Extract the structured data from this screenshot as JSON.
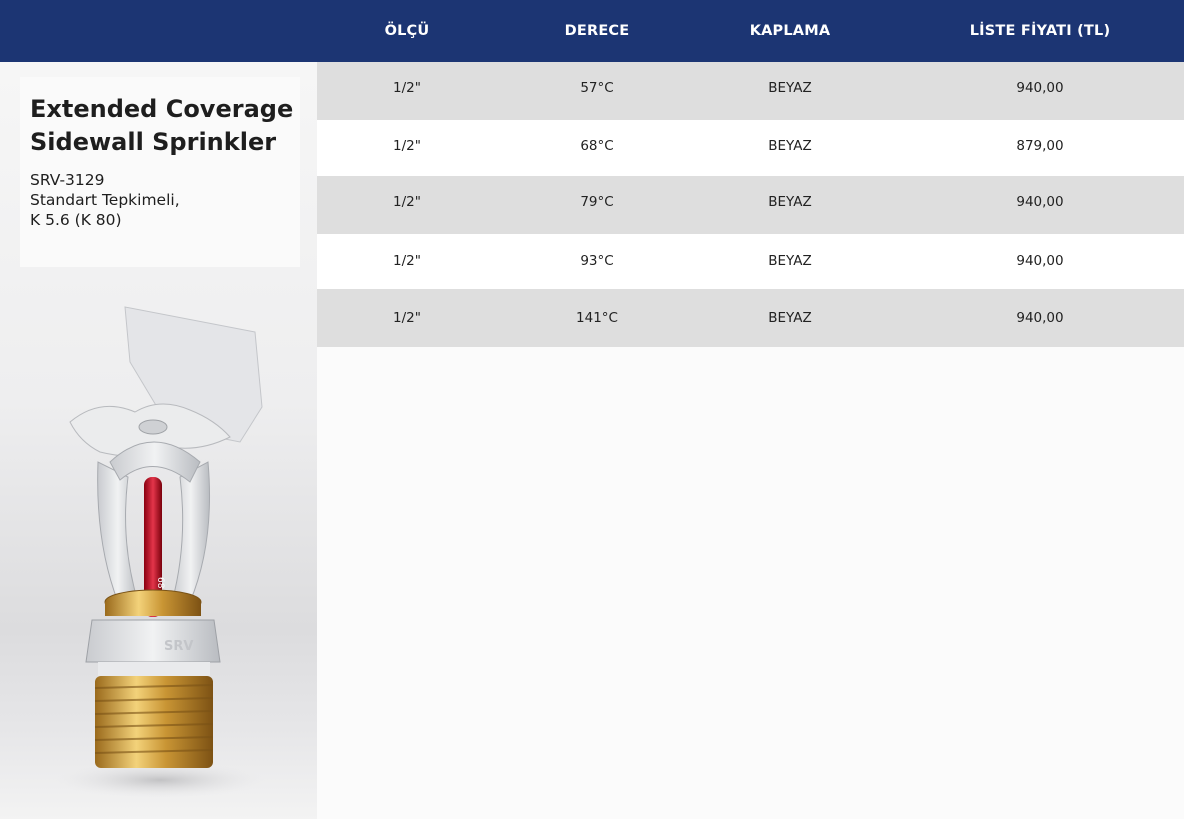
{
  "table": {
    "headers": [
      "ÖLÇÜ",
      "DERECE",
      "KAPLAMA",
      "LİSTE FİYATI (TL)"
    ],
    "rows": [
      {
        "size": "1/2\"",
        "degree": "57°C",
        "coating": "BEYAZ",
        "price": "940,00"
      },
      {
        "size": "1/2\"",
        "degree": "68°C",
        "coating": "BEYAZ",
        "price": "879,00"
      },
      {
        "size": "1/2\"",
        "degree": "79°C",
        "coating": "BEYAZ",
        "price": "940,00"
      },
      {
        "size": "1/2\"",
        "degree": "93°C",
        "coating": "BEYAZ",
        "price": "940,00"
      },
      {
        "size": "1/2\"",
        "degree": "141°C",
        "coating": "BEYAZ",
        "price": "940,00"
      }
    ]
  },
  "product": {
    "title": "Extended Coverage Sidewall Sprinkler",
    "code": "SRV-3129",
    "response": "Standart Tepkimeli,",
    "k_factor": "K 5.6 (K 80)",
    "image_icon": "sidewall-sprinkler-image",
    "body_mark": "SRV",
    "bulb_mark": "68 SS"
  }
}
